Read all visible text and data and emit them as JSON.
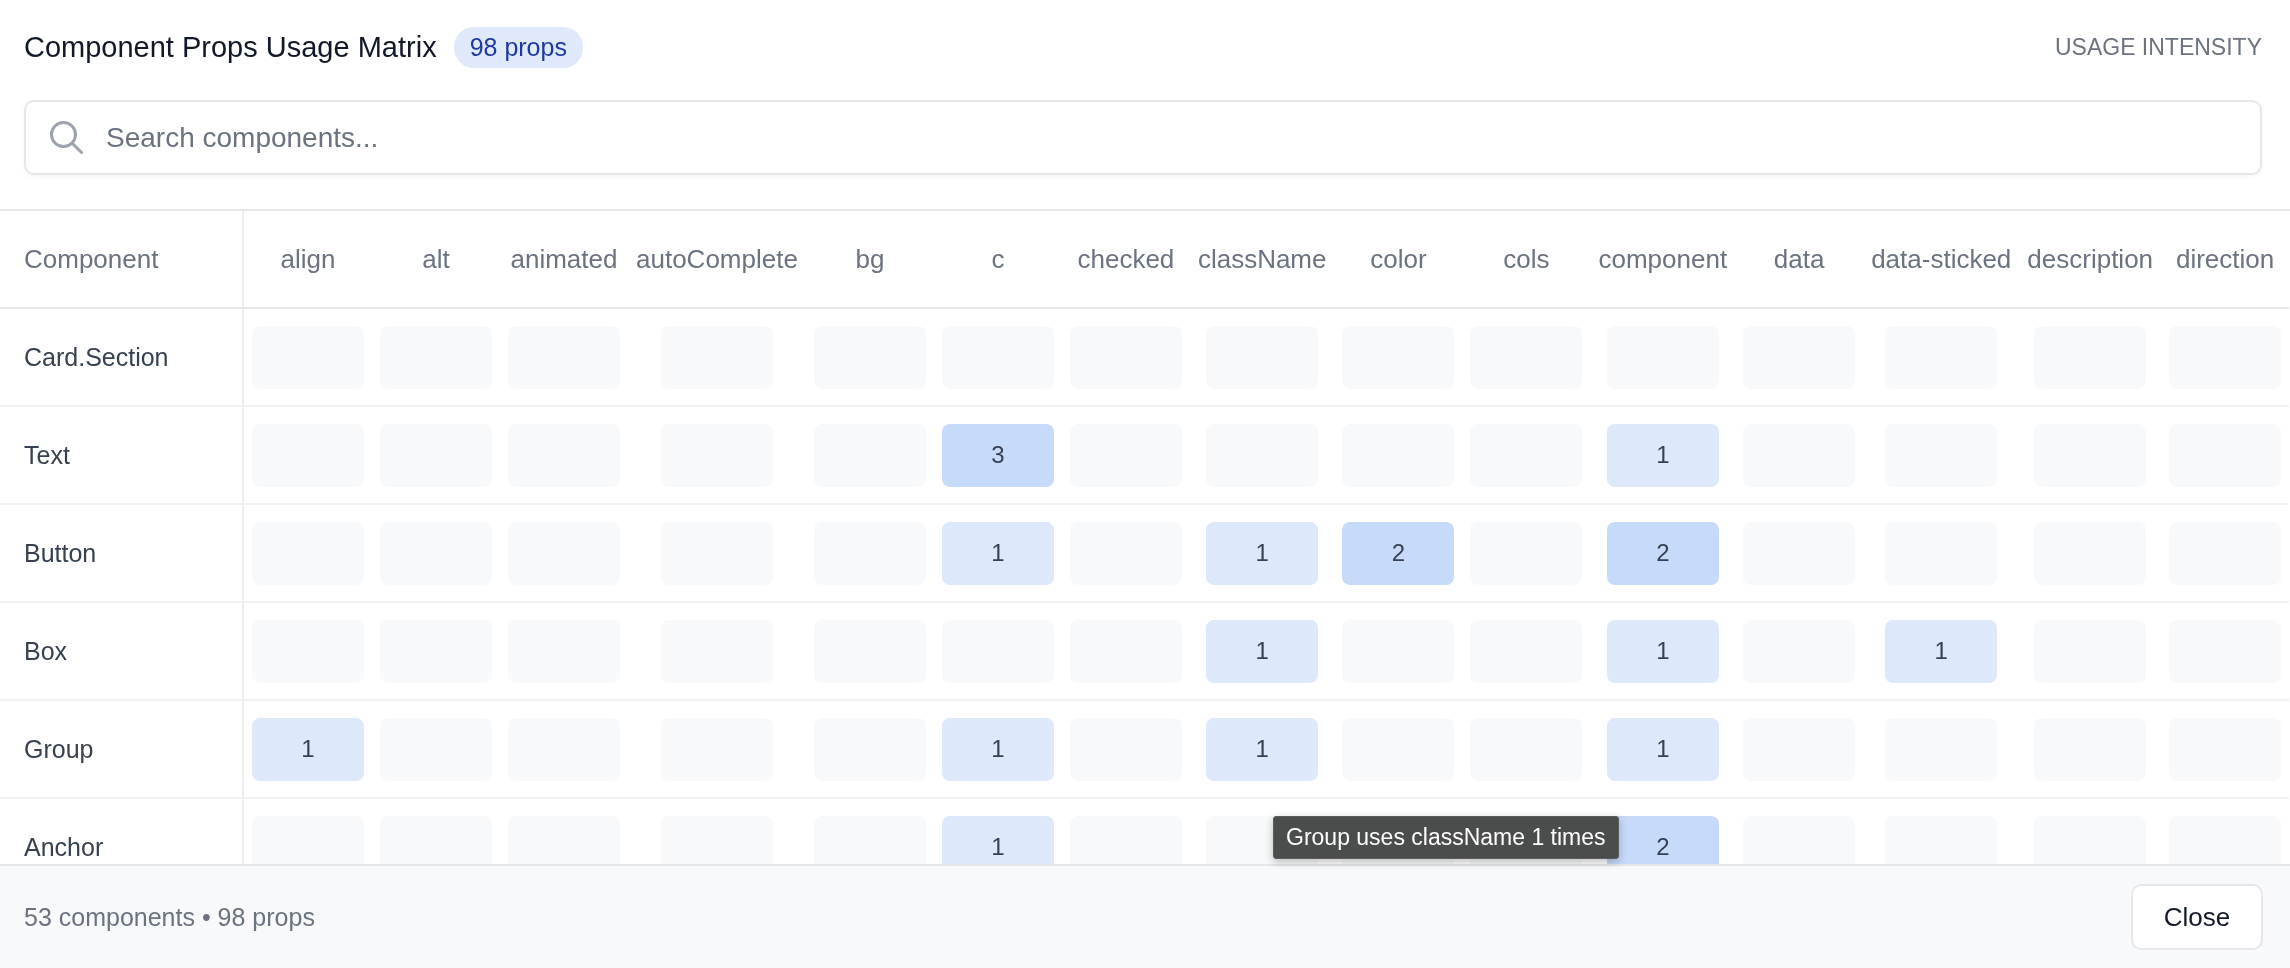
{
  "title": "Component Props Usage Matrix",
  "badge": "98 props",
  "legend_label": "USAGE INTENSITY",
  "search": {
    "placeholder": "Search components..."
  },
  "table": {
    "corner_header": "Component",
    "columns": [
      "align",
      "alt",
      "animated",
      "autoComplete",
      "bg",
      "c",
      "checked",
      "className",
      "color",
      "cols",
      "component",
      "data",
      "data-sticked",
      "description",
      "direction"
    ],
    "rows": [
      {
        "name": "Card.Section",
        "cells": [
          null,
          null,
          null,
          null,
          null,
          null,
          null,
          null,
          null,
          null,
          null,
          null,
          null,
          null,
          null
        ]
      },
      {
        "name": "Text",
        "cells": [
          null,
          null,
          null,
          null,
          null,
          {
            "count": "3",
            "color": "#c6dafa"
          },
          null,
          null,
          null,
          null,
          {
            "count": "1",
            "color": "#dde8fb"
          },
          null,
          null,
          null,
          null
        ]
      },
      {
        "name": "Button",
        "cells": [
          null,
          null,
          null,
          null,
          null,
          {
            "count": "1",
            "color": "#dde8fb"
          },
          null,
          {
            "count": "1",
            "color": "#dde8fb"
          },
          {
            "count": "2",
            "color": "#c6dafa"
          },
          null,
          {
            "count": "2",
            "color": "#c6dafa"
          },
          null,
          null,
          null,
          null
        ]
      },
      {
        "name": "Box",
        "cells": [
          null,
          null,
          null,
          null,
          null,
          null,
          null,
          {
            "count": "1",
            "color": "#dde8fb"
          },
          null,
          null,
          {
            "count": "1",
            "color": "#dde8fb"
          },
          null,
          {
            "count": "1",
            "color": "#dde8fb"
          },
          null,
          null
        ]
      },
      {
        "name": "Group",
        "cells": [
          {
            "count": "1",
            "color": "#dde8fb"
          },
          null,
          null,
          null,
          null,
          {
            "count": "1",
            "color": "#dde8fb"
          },
          null,
          {
            "count": "1",
            "color": "#dde8fb"
          },
          null,
          null,
          {
            "count": "1",
            "color": "#dde8fb"
          },
          null,
          null,
          null,
          null
        ]
      },
      {
        "name": "Anchor",
        "cells": [
          null,
          null,
          null,
          null,
          null,
          {
            "count": "1",
            "color": "#dde8fb"
          },
          null,
          null,
          null,
          null,
          {
            "count": "2",
            "color": "#c6dafa"
          },
          null,
          null,
          null,
          null
        ]
      }
    ]
  },
  "tooltip": {
    "text": "Group uses className 1 times"
  },
  "footer": {
    "summary": "53 components • 98 props",
    "close_button": "Close"
  }
}
